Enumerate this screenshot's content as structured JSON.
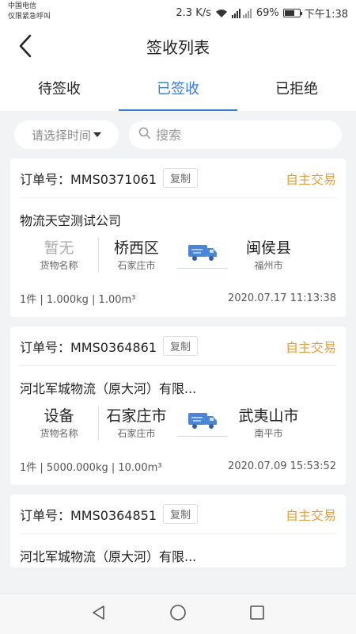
{
  "status_bar": {
    "carrier": "中国电信",
    "carrier_note": "仅限紧急呼叫",
    "speed": "2.3 K/s",
    "battery": "69%",
    "battery_level": 0.69,
    "time": "下午1:38"
  },
  "header": {
    "title": "签收列表",
    "back_icon": "chevron-left-icon"
  },
  "tabs": [
    {
      "label": "待签收",
      "active": false
    },
    {
      "label": "已签收",
      "active": true
    },
    {
      "label": "已拒绝",
      "active": false
    }
  ],
  "filters": {
    "time_select_label": "请选择时间",
    "search_placeholder": "搜索",
    "search_value": ""
  },
  "orders": [
    {
      "order_label": "订单号：MMS0371061",
      "copy_label": "复制",
      "trade_type": "自主交易",
      "company": "物流天空测试公司",
      "cargo_name": "暂无",
      "cargo_label": "货物名称",
      "origin_district": "桥西区",
      "origin_city": "石家庄市",
      "dest_district": "闽侯县",
      "dest_city": "福州市",
      "summary": "1件 | 1.000kg | 1.00m³",
      "date": "2020.07.17 11:13:38"
    },
    {
      "order_label": "订单号：MMS0364861",
      "copy_label": "复制",
      "trade_type": "自主交易",
      "company": "河北军城物流（原大河）有限...",
      "cargo_name": "设备",
      "cargo_label": "货物名称",
      "origin_district": "石家庄市",
      "origin_city": "石家庄市",
      "dest_district": "武夷山市",
      "dest_city": "南平市",
      "summary": "1件 | 5000.000kg | 10.00m³",
      "date": "2020.07.09 15:53:52"
    },
    {
      "order_label": "订单号：MMS0364851",
      "copy_label": "复制",
      "trade_type": "自主交易",
      "company": "河北军城物流（原大河）有限..."
    }
  ],
  "colors": {
    "accent": "#3a7bd5",
    "trade": "#e0a040",
    "background": "#f2f3f5"
  }
}
